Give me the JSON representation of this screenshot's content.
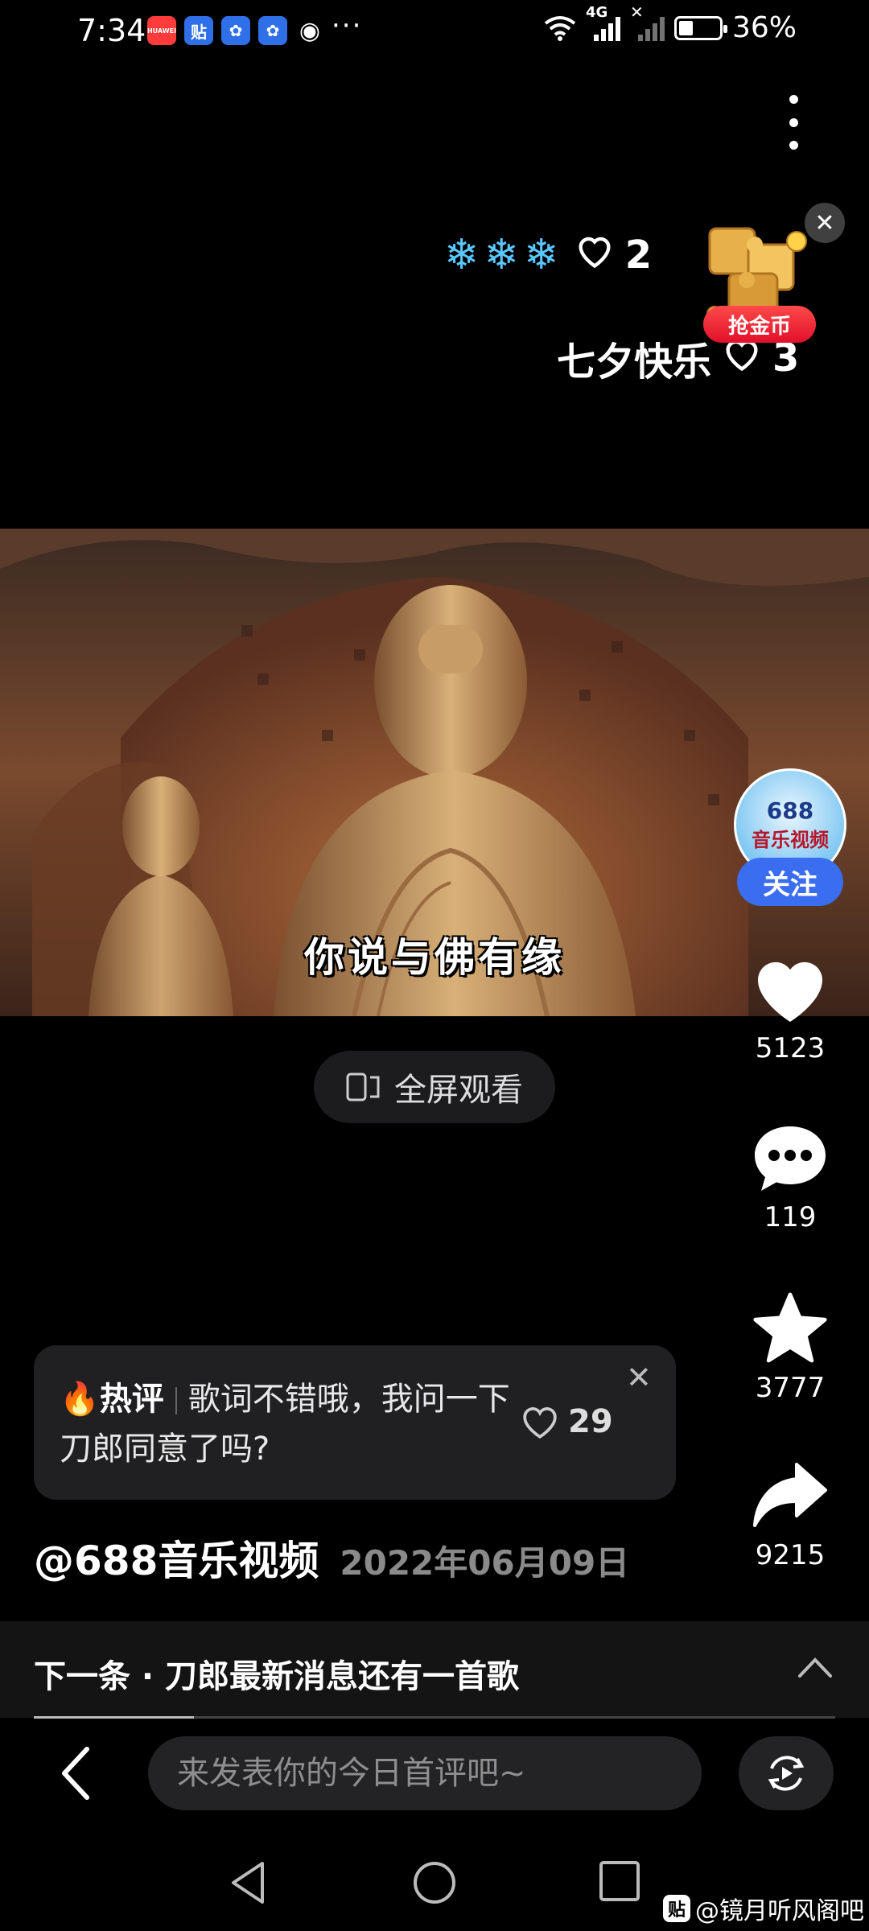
{
  "status_bar": {
    "time": "7:34",
    "apps": [
      {
        "icon": "huawei-app-icon",
        "glyph": "HUAWEI",
        "bg": "#ff3b3b"
      },
      {
        "icon": "tieba-app-icon",
        "glyph": "贴",
        "bg": "#2f6fe8"
      },
      {
        "icon": "baidu-app-icon",
        "glyph": "✿",
        "bg": "#2f6fe8"
      },
      {
        "icon": "baidu-app-icon-2",
        "glyph": "✿",
        "bg": "#2f6fe8"
      },
      {
        "icon": "wechat-app-icon",
        "glyph": "◉",
        "bg": "transparent"
      }
    ],
    "more": "···",
    "network": "4G",
    "battery": "36%",
    "battery_level": 0.36
  },
  "danmaku": [
    {
      "decor": "❄❄❄",
      "likes": "2"
    },
    {
      "text": "七夕快乐",
      "likes": "3"
    }
  ],
  "coin_widget": {
    "label": "抢金币",
    "close": "✕"
  },
  "video": {
    "subtitle": "你说与佛有缘"
  },
  "fullscreen_button": {
    "label": "全屏观看"
  },
  "creator": {
    "avatar_line1": "688",
    "avatar_line2": "音乐视频",
    "follow_label": "关注"
  },
  "actions": {
    "like_count": "5123",
    "comment_count": "119",
    "favorite_count": "3777",
    "share_count": "9215"
  },
  "hot_comment": {
    "tag": "热评",
    "text": "歌词不错哦，我问一下刀郎同意了吗?",
    "likes": "29",
    "close": "✕"
  },
  "post": {
    "author": "@688音乐视频",
    "date": "2022年06月09日"
  },
  "next": {
    "text": "下一条 · 刀郎最新消息还有一首歌",
    "progress": 0.2
  },
  "comment_input": {
    "placeholder": "来发表你的今日首评吧~"
  },
  "watermark": {
    "badge": "贴",
    "text": "@镜月听风阁吧"
  },
  "colors": {
    "accent_blue": "#3a6df0",
    "coin_red": "#e0102a",
    "snow_blue": "#5ac8ff"
  }
}
